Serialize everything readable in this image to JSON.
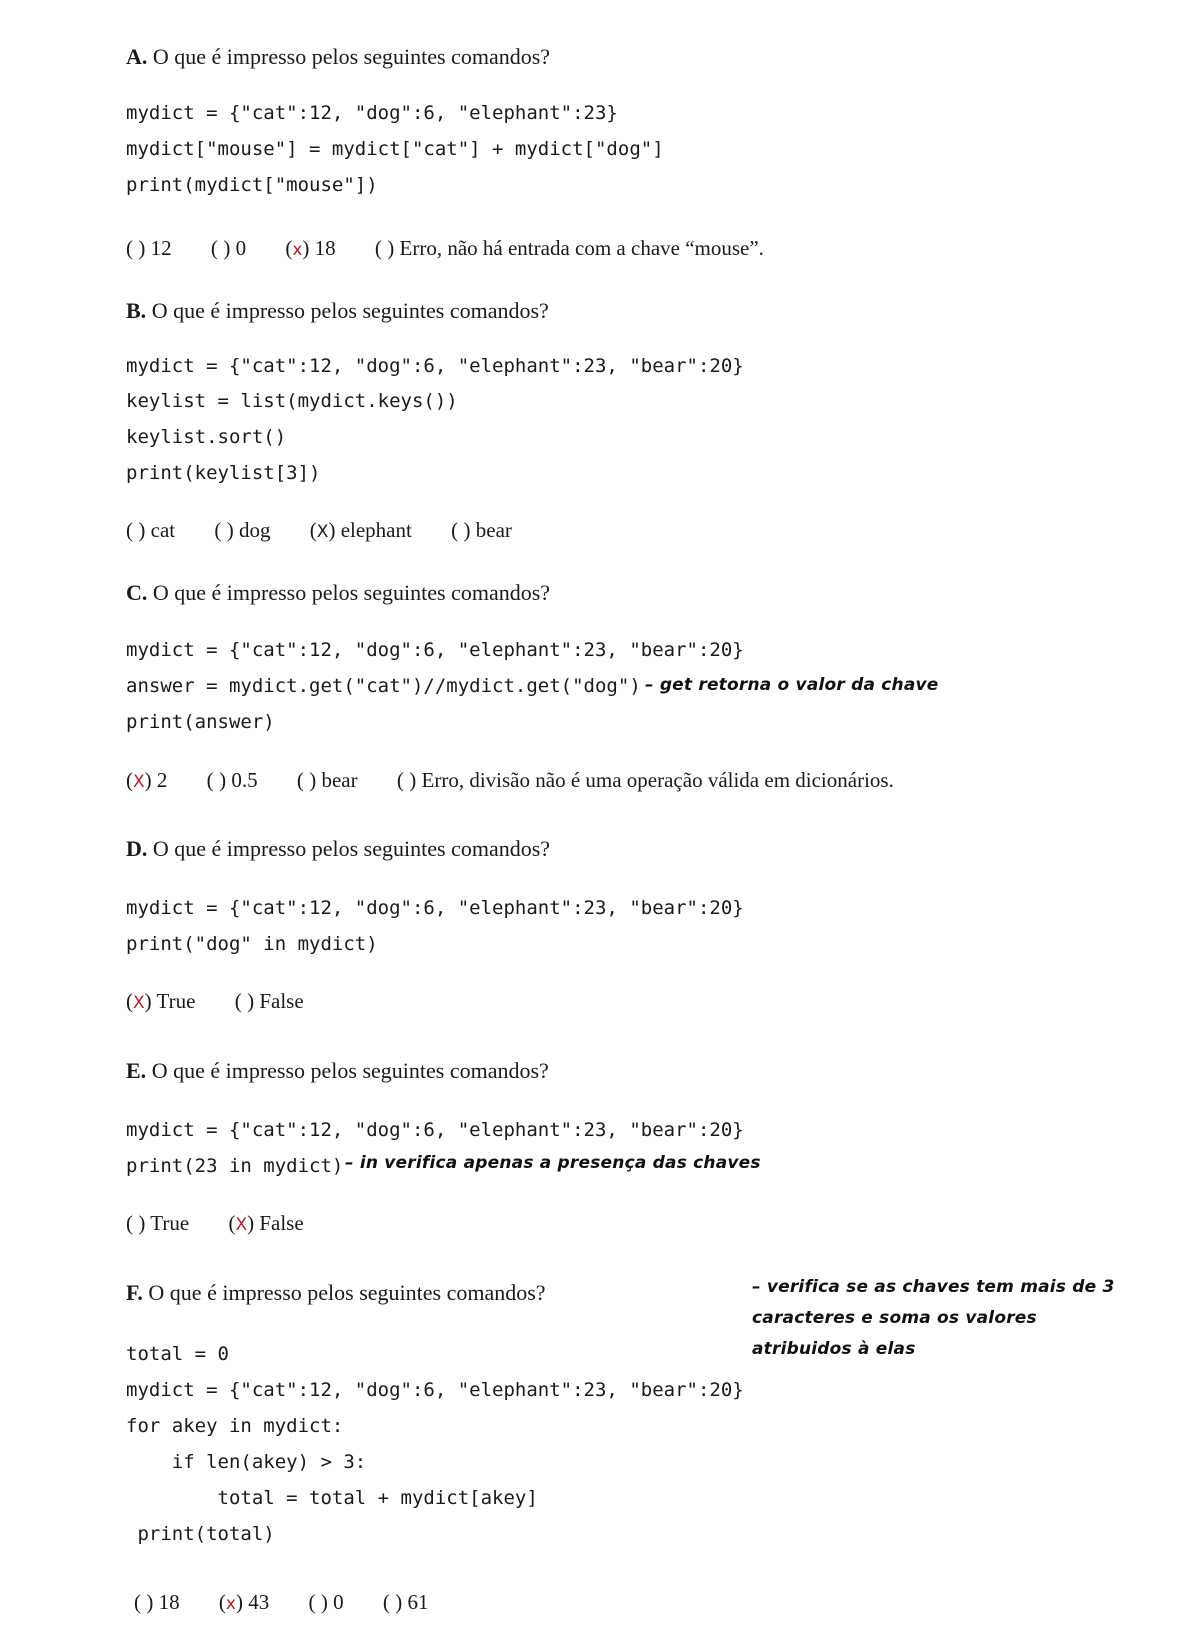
{
  "questions": [
    {
      "letter": "A.",
      "prompt": "O que é impresso pelos seguintes comandos?",
      "code": [
        "mydict = {\"cat\":12, \"dog\":6, \"elephant\":23}",
        "mydict[\"mouse\"] = mydict[\"cat\"] + mydict[\"dog\"]",
        "print(mydict[\"mouse\"])"
      ],
      "options": [
        {
          "text": "12",
          "marked": false
        },
        {
          "text": "0",
          "marked": false
        },
        {
          "text": "18",
          "marked": true
        },
        {
          "text": "Erro, não há entrada com a chave “mouse”.",
          "marked": false
        }
      ]
    },
    {
      "letter": "B.",
      "prompt": "O que é impresso pelos seguintes comandos?",
      "code": [
        "mydict = {\"cat\":12, \"dog\":6, \"elephant\":23, \"bear\":20}",
        "keylist = list(mydict.keys())",
        "keylist.sort()",
        "print(keylist[3])"
      ],
      "options": [
        {
          "text": "cat",
          "marked": false
        },
        {
          "text": "dog",
          "marked": false
        },
        {
          "text": "elephant",
          "marked": true
        },
        {
          "text": "bear",
          "marked": false
        }
      ]
    },
    {
      "letter": "C.",
      "prompt": "O que é impresso pelos seguintes comandos?",
      "code": [
        "mydict = {\"cat\":12, \"dog\":6, \"elephant\":23, \"bear\":20}",
        "answer = mydict.get(\"cat\")//mydict.get(\"dog\")",
        "print(answer)"
      ],
      "options": [
        {
          "text": "2",
          "marked": true
        },
        {
          "text": "0.5",
          "marked": false
        },
        {
          "text": "bear",
          "marked": false
        },
        {
          "text": "Erro, divisão não é uma operação válida em dicionários.",
          "marked": false
        }
      ]
    },
    {
      "letter": "D.",
      "prompt": "O que é impresso pelos seguintes comandos?",
      "code": [
        "mydict = {\"cat\":12, \"dog\":6, \"elephant\":23, \"bear\":20}",
        "print(\"dog\" in mydict)"
      ],
      "options": [
        {
          "text": "True",
          "marked": true
        },
        {
          "text": "False",
          "marked": false
        }
      ]
    },
    {
      "letter": "E.",
      "prompt": "O que é impresso pelos seguintes comandos?",
      "code": [
        "mydict = {\"cat\":12, \"dog\":6, \"elephant\":23, \"bear\":20}",
        "print(23 in mydict)"
      ],
      "options": [
        {
          "text": "True",
          "marked": false
        },
        {
          "text": "False",
          "marked": true
        }
      ]
    },
    {
      "letter": "F.",
      "prompt": "O que é impresso pelos seguintes comandos?",
      "code": [
        "total = 0",
        "mydict = {\"cat\":12, \"dog\":6, \"elephant\":23, \"bear\":20}",
        "for akey in mydict:",
        "    if len(akey) > 3:",
        "        total = total + mydict[akey]",
        " print(total)"
      ],
      "options": [
        {
          "text": "18",
          "marked": false
        },
        {
          "text": "43",
          "marked": true
        },
        {
          "text": "0",
          "marked": false
        },
        {
          "text": "61",
          "marked": false
        }
      ]
    }
  ],
  "notes": {
    "c_note": "– get retorna o valor da chave",
    "e_note": "– in verifica apenas a presença das chaves",
    "f_note": "– verifica se as chaves tem mais de 3 caracteres e soma os valores atribuidos à elas"
  },
  "mark_char": "X",
  "colors": {
    "mark": "#b8202a",
    "text": "#1a1a1a"
  }
}
